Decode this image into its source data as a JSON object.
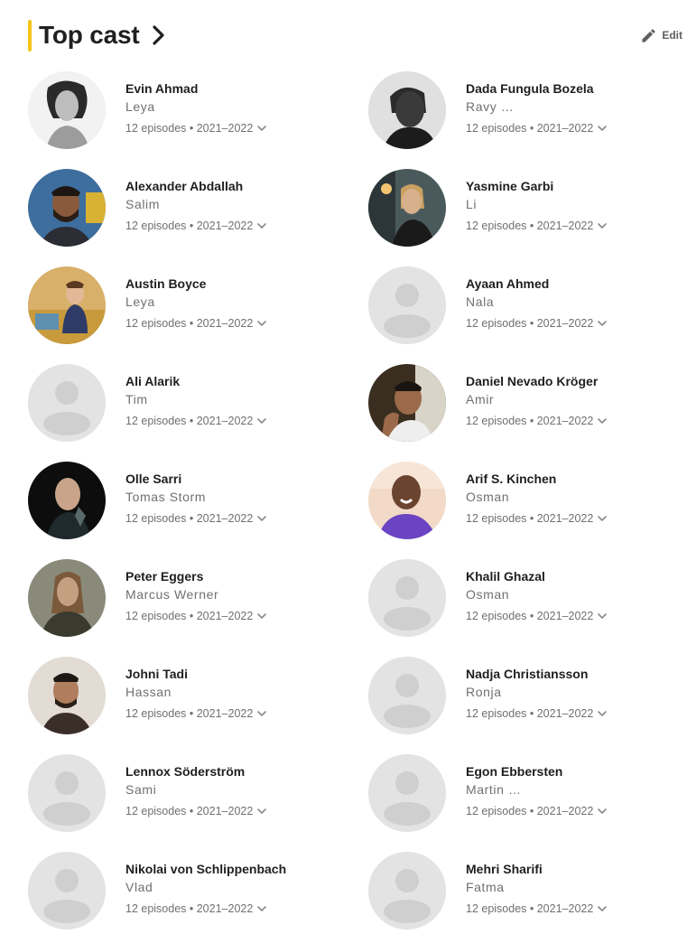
{
  "header": {
    "title": "Top cast",
    "edit_label": "Edit"
  },
  "colors": {
    "accent": "#f5c518",
    "placeholder_bg": "#e3e3e3",
    "placeholder_fg": "#cfcfcf"
  },
  "cast": [
    {
      "name": "Evin Ahmad",
      "character": "Leya",
      "episodes": "12 episodes • 2021–2022",
      "photo": "portrait-bw-woman"
    },
    {
      "name": "Dada Fungula Bozela",
      "character": "Ravy …",
      "episodes": "12 episodes • 2021–2022",
      "photo": "portrait-bw-man"
    },
    {
      "name": "Alexander Abdallah",
      "character": "Salim",
      "episodes": "12 episodes • 2021–2022",
      "photo": "portrait-man-blue-bg"
    },
    {
      "name": "Yasmine Garbi",
      "character": "Li",
      "episodes": "12 episodes • 2021–2022",
      "photo": "portrait-woman-night"
    },
    {
      "name": "Austin Boyce",
      "character": "Leya",
      "episodes": "12 episodes • 2021–2022",
      "photo": "portrait-boy-room"
    },
    {
      "name": "Ayaan Ahmed",
      "character": "Nala",
      "episodes": "12 episodes • 2021–2022",
      "photo": "placeholder"
    },
    {
      "name": "Ali Alarik",
      "character": "Tim",
      "episodes": "12 episodes • 2021–2022",
      "photo": "placeholder"
    },
    {
      "name": "Daniel Nevado Kröger",
      "character": "Amir",
      "episodes": "12 episodes • 2021–2022",
      "photo": "portrait-man-dark-bg"
    },
    {
      "name": "Olle Sarri",
      "character": "Tomas Storm",
      "episodes": "12 episodes • 2021–2022",
      "photo": "portrait-man-black-bg"
    },
    {
      "name": "Arif S. Kinchen",
      "character": "Osman",
      "episodes": "12 episodes • 2021–2022",
      "photo": "portrait-man-purple-shirt"
    },
    {
      "name": "Peter Eggers",
      "character": "Marcus Werner",
      "episodes": "12 episodes • 2021–2022",
      "photo": "portrait-man-longhair"
    },
    {
      "name": "Khalil Ghazal",
      "character": "Osman",
      "episodes": "12 episodes • 2021–2022",
      "photo": "placeholder"
    },
    {
      "name": "Johni Tadi",
      "character": "Hassan",
      "episodes": "12 episodes • 2021–2022",
      "photo": "portrait-man-light-bg"
    },
    {
      "name": "Nadja Christiansson",
      "character": "Ronja",
      "episodes": "12 episodes • 2021–2022",
      "photo": "placeholder"
    },
    {
      "name": "Lennox Söderström",
      "character": "Sami",
      "episodes": "12 episodes • 2021–2022",
      "photo": "placeholder"
    },
    {
      "name": "Egon Ebbersten",
      "character": "Martin …",
      "episodes": "12 episodes • 2021–2022",
      "photo": "placeholder"
    },
    {
      "name": "Nikolai von Schlippenbach",
      "character": "Vlad",
      "episodes": "12 episodes • 2021–2022",
      "photo": "placeholder"
    },
    {
      "name": "Mehri Sharifi",
      "character": "Fatma",
      "episodes": "12 episodes • 2021–2022",
      "photo": "placeholder"
    }
  ]
}
